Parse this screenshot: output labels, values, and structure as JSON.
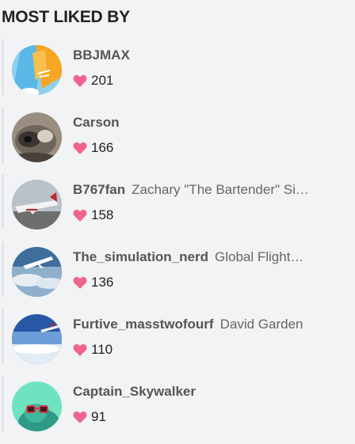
{
  "heading": "MOST LIKED BY",
  "users": [
    {
      "username": "BBJMAX",
      "full_name": "",
      "likes": "201",
      "avatar": "balloon-avatar"
    },
    {
      "username": "Carson",
      "full_name": "",
      "likes": "166",
      "avatar": "raccoon-avatar"
    },
    {
      "username": "B767fan",
      "full_name": "Zachary \"The Bartender\" Si…",
      "likes": "158",
      "avatar": "airplane-avatar"
    },
    {
      "username": "The_simulation_nerd",
      "full_name": "Global Flight…",
      "likes": "136",
      "avatar": "jet-above-clouds-avatar"
    },
    {
      "username": "Furtive_masstwofourf",
      "full_name": "David Garden",
      "likes": "110",
      "avatar": "jet-in-sky-avatar"
    },
    {
      "username": "Captain_Skywalker",
      "full_name": "",
      "likes": "91",
      "avatar": "sunglasses-avatar"
    }
  ],
  "colors": {
    "heart": "#f0648c",
    "background": "#f1f3f5"
  }
}
